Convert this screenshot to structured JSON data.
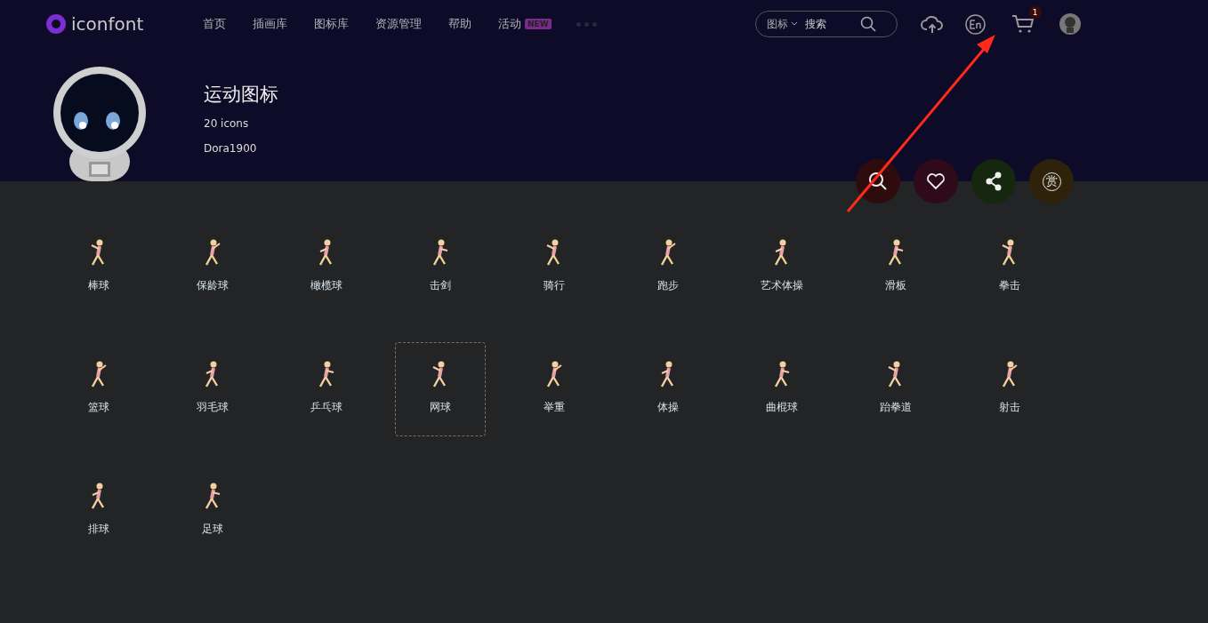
{
  "header": {
    "logo": "iconfont",
    "nav": [
      {
        "label": "首页"
      },
      {
        "label": "插画库"
      },
      {
        "label": "图标库"
      },
      {
        "label": "资源管理"
      },
      {
        "label": "帮助"
      },
      {
        "label": "活动",
        "badge": "NEW"
      }
    ],
    "search": {
      "scope": "图标",
      "placeholder": "搜索"
    },
    "cart_count": "1"
  },
  "collection": {
    "title": "运动图标",
    "count": "20 icons",
    "author": "Dora1900"
  },
  "actions": [
    {
      "kind": "search",
      "color": "#2e0c0d"
    },
    {
      "kind": "like",
      "color": "#2e0a1a"
    },
    {
      "kind": "share",
      "color": "#16270f"
    },
    {
      "kind": "reward",
      "glyph": "赏",
      "color": "#2e220b"
    }
  ],
  "icons": [
    {
      "name": "棒球",
      "selected": false
    },
    {
      "name": "保龄球",
      "selected": false
    },
    {
      "name": "橄榄球",
      "selected": false
    },
    {
      "name": "击剑",
      "selected": false
    },
    {
      "name": "骑行",
      "selected": false
    },
    {
      "name": "跑步",
      "selected": false
    },
    {
      "name": "艺术体操",
      "selected": false
    },
    {
      "name": "滑板",
      "selected": false
    },
    {
      "name": "拳击",
      "selected": false
    },
    {
      "name": "篮球",
      "selected": false
    },
    {
      "name": "羽毛球",
      "selected": false
    },
    {
      "name": "乒乓球",
      "selected": false
    },
    {
      "name": "网球",
      "selected": true
    },
    {
      "name": "举重",
      "selected": false
    },
    {
      "name": "体操",
      "selected": false
    },
    {
      "name": "曲棍球",
      "selected": false
    },
    {
      "name": "跆拳道",
      "selected": false
    },
    {
      "name": "射击",
      "selected": false
    },
    {
      "name": "排球",
      "selected": false
    },
    {
      "name": "足球",
      "selected": false
    }
  ]
}
